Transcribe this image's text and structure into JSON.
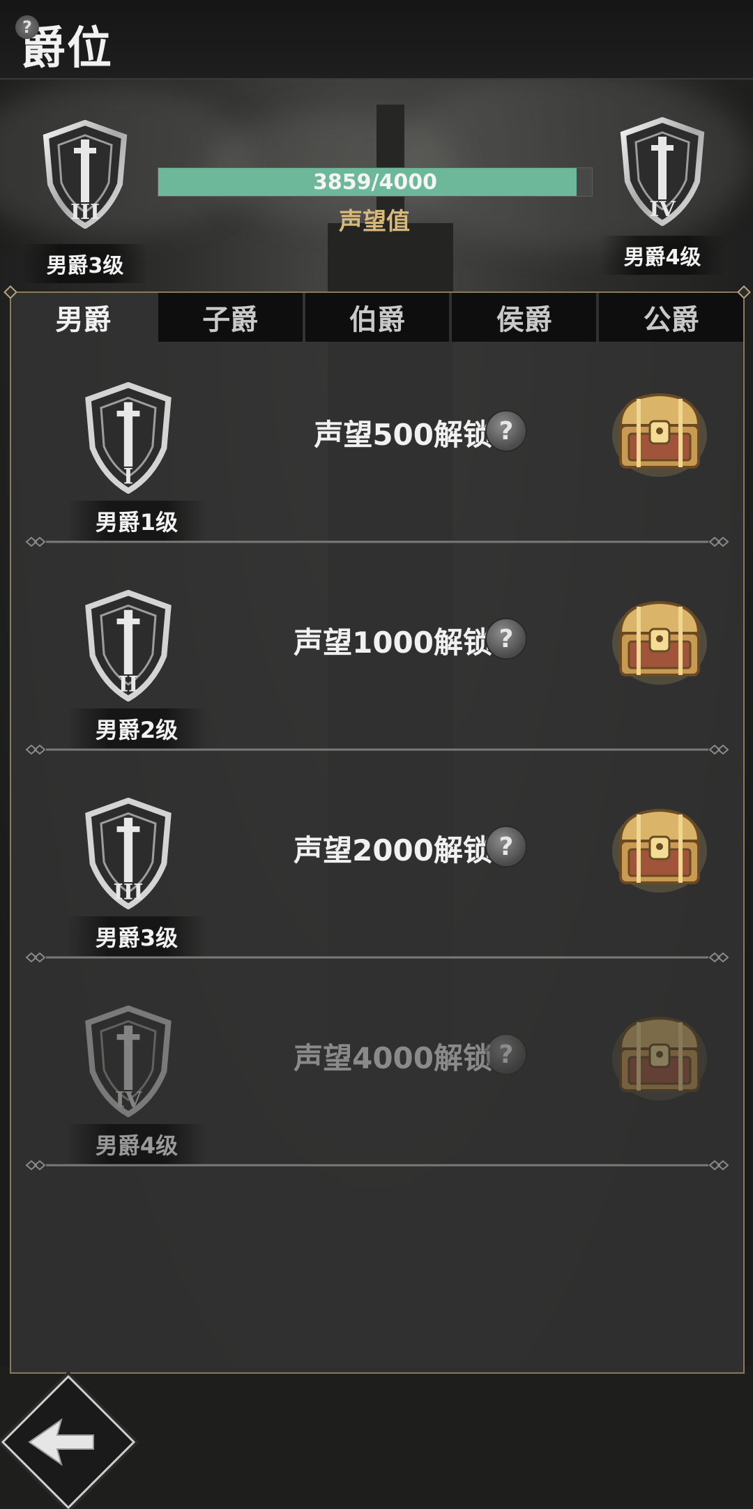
{
  "header": {
    "title": "爵位",
    "help_glyph": "?"
  },
  "progress": {
    "current_rank": "男爵3级",
    "next_rank": "男爵4级",
    "text": "3859/4000",
    "value": 3859,
    "max": 4000,
    "label": "声望值"
  },
  "tabs": [
    {
      "label": "男爵",
      "active": true
    },
    {
      "label": "子爵",
      "active": false
    },
    {
      "label": "伯爵",
      "active": false
    },
    {
      "label": "侯爵",
      "active": false
    },
    {
      "label": "公爵",
      "active": false
    }
  ],
  "rows": [
    {
      "level": "男爵1级",
      "numeral": "I",
      "unlock": "声望500解锁",
      "help": "?",
      "locked": false
    },
    {
      "level": "男爵2级",
      "numeral": "II",
      "unlock": "声望1000解锁",
      "help": "?",
      "locked": false
    },
    {
      "level": "男爵3级",
      "numeral": "III",
      "unlock": "声望2000解锁",
      "help": "?",
      "locked": false
    },
    {
      "level": "男爵4级",
      "numeral": "IV",
      "unlock": "声望4000解锁",
      "help": "?",
      "locked": true
    }
  ],
  "colors": {
    "accent": "#6db79a",
    "gold": "#d8b97a",
    "panel_border": "#8a7a5e"
  },
  "icons": {
    "shield": "shield-sword-icon",
    "chest": "treasure-chest-icon",
    "back": "back-arrow-icon",
    "help": "question-icon"
  }
}
